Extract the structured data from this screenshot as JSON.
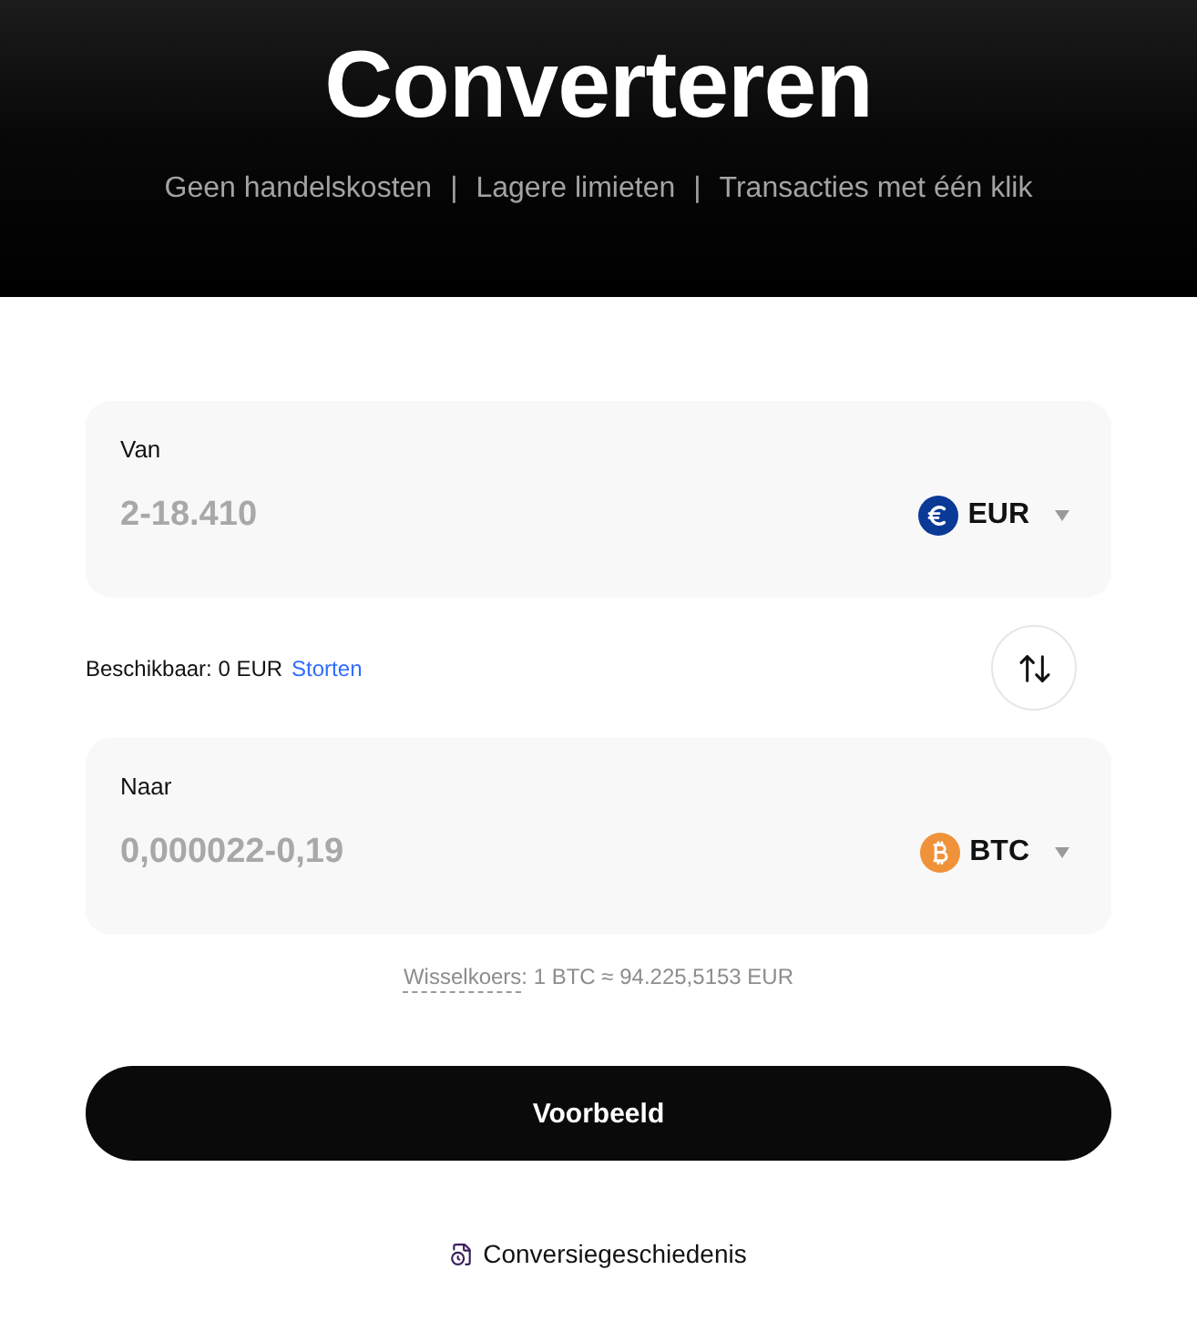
{
  "header": {
    "title": "Converteren",
    "features": [
      "Geen handelskosten",
      "Lagere limieten",
      "Transacties met één klik"
    ],
    "separator": "|"
  },
  "from": {
    "label": "Van",
    "placeholder": "2-18.410",
    "currency": {
      "kind": "eur",
      "code": "EUR"
    }
  },
  "balance": {
    "text": "Beschikbaar: 0 EUR",
    "link": "Storten"
  },
  "to": {
    "label": "Naar",
    "placeholder": "0,000022-0,19",
    "currency": {
      "kind": "btc",
      "code": "BTC"
    }
  },
  "rate": {
    "term": "Wisselkoers",
    "value": ": 1 BTC ≈ 94.225,5153 EUR"
  },
  "primary_button": "Voorbeeld",
  "history_link": "Conversiegeschiedenis"
}
